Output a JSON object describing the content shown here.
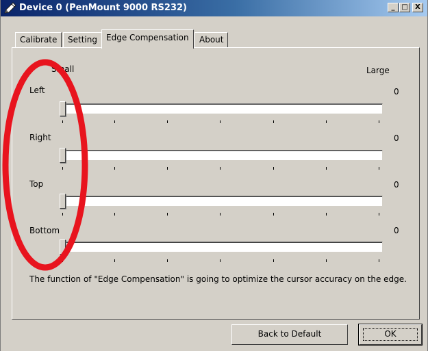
{
  "window": {
    "title": "Device 0 (PenMount 9000 RS232)",
    "controls": {
      "minimize": "_",
      "maximize": "□",
      "close": "X"
    }
  },
  "tabs": [
    {
      "label": "Calibrate",
      "active": false
    },
    {
      "label": "Setting",
      "active": false
    },
    {
      "label": "Edge Compensation",
      "active": true
    },
    {
      "label": "About",
      "active": false
    }
  ],
  "scale": {
    "min_label": "Small",
    "max_label": "Large"
  },
  "sliders": [
    {
      "label": "Left",
      "value": "0",
      "level": 0
    },
    {
      "label": "Right",
      "value": "0",
      "level": 0
    },
    {
      "label": "Top",
      "value": "0",
      "level": 0
    },
    {
      "label": "Bottom",
      "value": "0",
      "level": 0
    }
  ],
  "description": "The function of \"Edge Compensation\" is going to optimize the cursor accuracy on the edge.",
  "buttons": {
    "back_to_default": "Back to Default",
    "ok": "OK"
  },
  "annotation": {
    "shape": "ellipse",
    "color": "#e8141e"
  },
  "colors": {
    "face": "#d4d0c8",
    "title_start": "#0a246a",
    "title_end": "#a6caf0"
  },
  "icons": {
    "title": "pen-icon"
  }
}
